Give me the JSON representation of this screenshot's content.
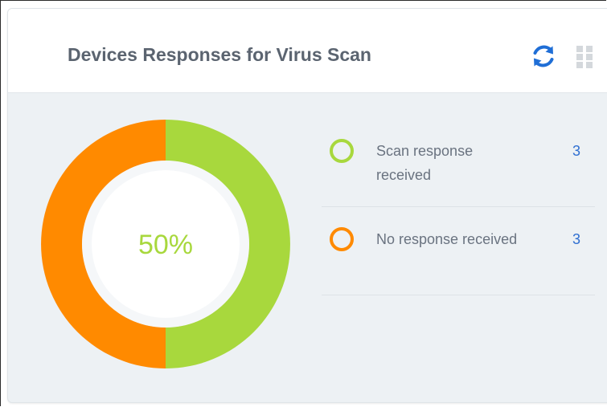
{
  "widget": {
    "title": "Devices Responses for Virus Scan",
    "refresh_icon": "refresh-icon",
    "drag_icon": "grid-drag-icon"
  },
  "colors": {
    "received": "#a8d83d",
    "no_response": "#ff8a00",
    "accent_blue": "#2f6fd1"
  },
  "chart_data": {
    "type": "pie",
    "center_label": "50%",
    "categories": [
      "Scan response received",
      "No response received"
    ],
    "values": [
      3,
      3
    ],
    "colors": [
      "#a8d83d",
      "#ff8a00"
    ]
  },
  "legend": [
    {
      "label": "Scan response received",
      "count": "3",
      "color": "#a8d83d"
    },
    {
      "label": "No response received",
      "count": "3",
      "color": "#ff8a00"
    }
  ]
}
